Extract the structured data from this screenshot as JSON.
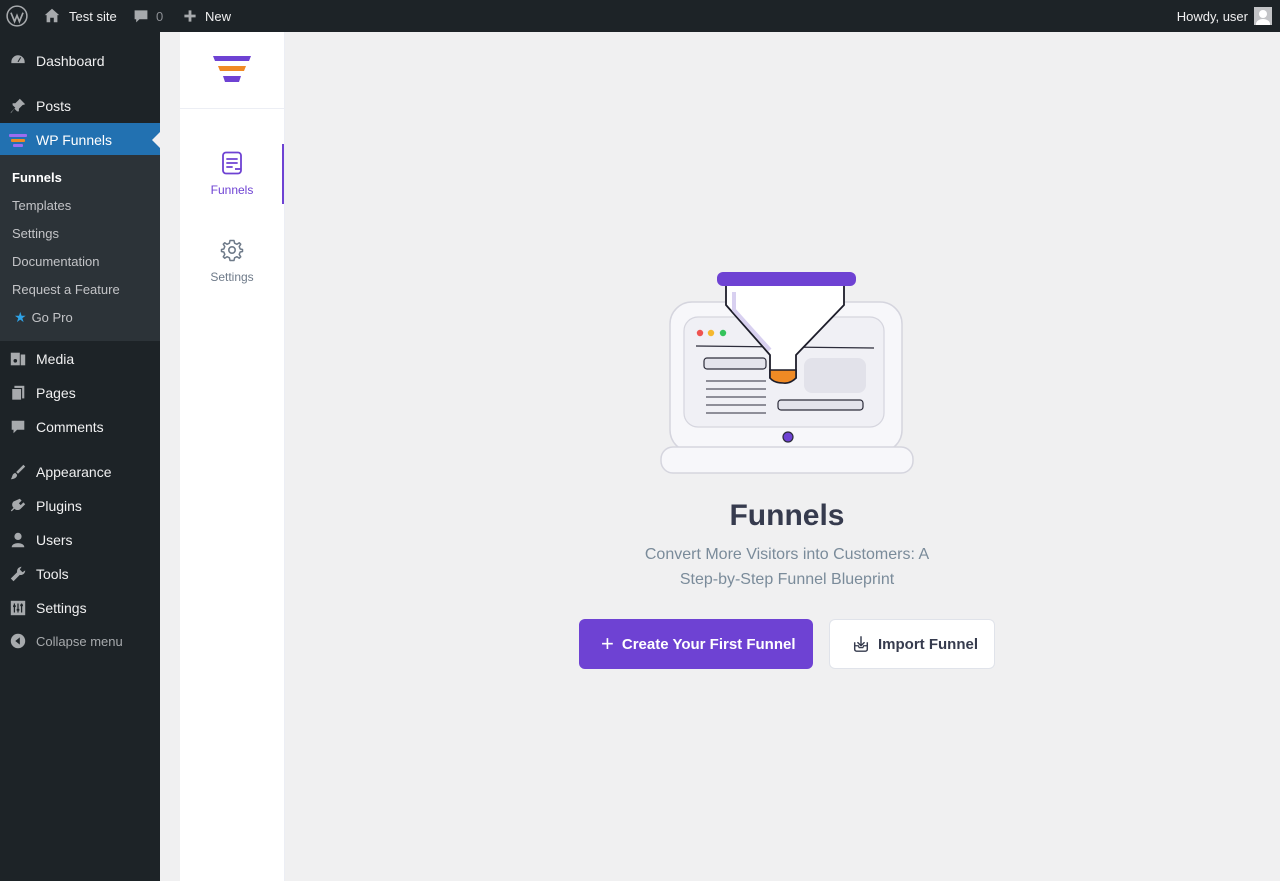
{
  "adminbar": {
    "site_name": "Test site",
    "comments_count": "0",
    "new_label": "New",
    "howdy": "Howdy, user"
  },
  "menu": {
    "dashboard": "Dashboard",
    "posts": "Posts",
    "wp_funnels": "WP Funnels",
    "submenu": [
      "Funnels",
      "Templates",
      "Settings",
      "Documentation",
      "Request a Feature",
      "Go Pro"
    ],
    "media": "Media",
    "pages": "Pages",
    "comments": "Comments",
    "appearance": "Appearance",
    "plugins": "Plugins",
    "users": "Users",
    "tools": "Tools",
    "settings": "Settings",
    "collapse": "Collapse menu"
  },
  "plugin_nav": {
    "funnels": "Funnels",
    "settings": "Settings"
  },
  "main": {
    "title": "Funnels",
    "subtitle": "Convert More Visitors into Customers: A Step-by-Step Funnel Blueprint",
    "create_button": "Create Your First Funnel",
    "import_button": "Import Funnel"
  },
  "colors": {
    "accent": "#6e42d3",
    "wp_blue": "#2271b1",
    "admin_dark": "#1d2327",
    "funnel_orange": "#f08a24"
  }
}
